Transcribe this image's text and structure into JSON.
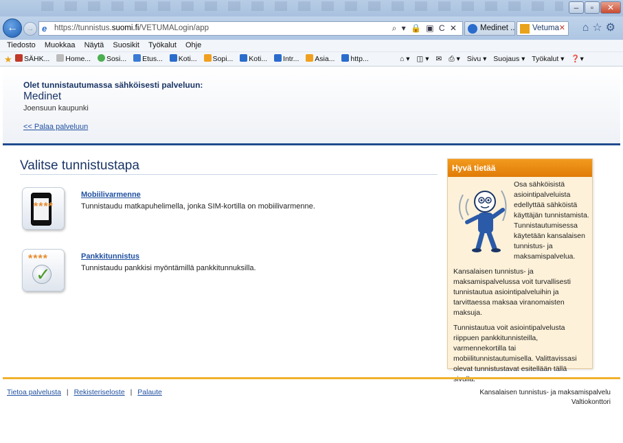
{
  "browser": {
    "url_prefix": "https://tunnistus.",
    "url_domain": "suomi.fi",
    "url_path": "/VETUMALogin/app",
    "address_tools": "⌕ ▾ 🔒 ▣ C ✕",
    "tabs": [
      {
        "label": "Medinet ...",
        "active": false
      },
      {
        "label": "Vetuma",
        "active": true
      }
    ],
    "menu": [
      "Tiedosto",
      "Muokkaa",
      "Näytä",
      "Suosikit",
      "Työkalut",
      "Ohje"
    ],
    "favorites": [
      "SÄHK...",
      "Home...",
      "Sosi...",
      "Etus...",
      "Koti...",
      "Sopi...",
      "Koti...",
      "Intr...",
      "Asia...",
      "http..."
    ],
    "command_bar": [
      "Sivu ▾",
      "Suojaus ▾",
      "Työkalut ▾"
    ]
  },
  "header": {
    "intro": "Olet tunnistautumassa sähköisesti palveluun:",
    "service_name": "Medinet",
    "organization": "Joensuun kaupunki",
    "back_link": "<< Palaa palveluun"
  },
  "main": {
    "title": "Valitse tunnistustapa",
    "methods": [
      {
        "name": "Mobiilivarmenne",
        "description": "Tunnistaudu matkapuhelimella, jonka SIM-kortilla on mobiilivarmenne.",
        "icon": "mobile-phone-icon"
      },
      {
        "name": "Pankkitunnistus",
        "description": "Tunnistaudu pankkisi myöntämillä pankkitunnuksilla.",
        "icon": "bank-check-icon"
      }
    ],
    "stars": "****"
  },
  "info": {
    "title": "Hyvä tietää",
    "p1": "Osa sähköisistä asiointipalveluista edellyttää sähköistä käyttäjän tunnistamista. Tunnistautumisessa käytetään kansalaisen tunnistus- ja maksamispalvelua.",
    "p2": "Kansalaisen tunnistus- ja maksamispalvelussa voit turvallisesti tunnistautua asiointipalveluihin ja tarvittaessa maksaa viranomaisten maksuja.",
    "p3": "Tunnistautua voit asiointipalvelusta riippuen pankkitunnisteilla, varmennekortilla tai mobiilitunnistautumisella. Valittavissasi olevat tunnistustavat esitellään tällä sivulla."
  },
  "footer": {
    "links": [
      "Tietoa palvelusta",
      "Rekisteriseloste",
      "Palaute"
    ],
    "separator": "|",
    "right_line1": "Kansalaisen tunnistus- ja maksamispalvelu",
    "right_line2": "Valtiokonttori"
  },
  "colors": {
    "header_rule": "#1f4a8e",
    "footer_rule": "#f0b12a",
    "info_header": "#e07c07",
    "link": "#1f4fa0"
  }
}
